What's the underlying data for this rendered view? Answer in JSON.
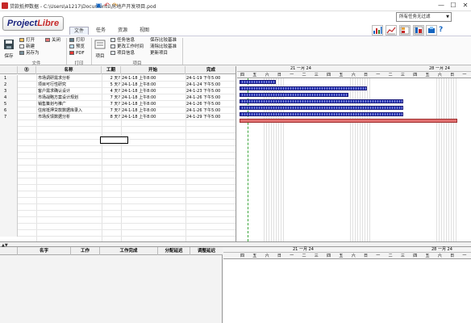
{
  "window": {
    "title": "贷款抵押数据 - C:\\Users\\a1217\\Documents\\房地产开发项目.pod",
    "minimize": "—",
    "maximize": "☐",
    "close": "✕"
  },
  "logo": {
    "text_main": "Project",
    "text_accent": "Libre"
  },
  "tabs": [
    "文件",
    "任务",
    "资源",
    "视图"
  ],
  "filter": {
    "value": "所有任务无过滤"
  },
  "ribbon": {
    "file_group": {
      "save": "保存",
      "open": "打开",
      "close": "关闭",
      "save_as": "另存为",
      "new": "新建",
      "label": "文件"
    },
    "print_group": {
      "print": "打印",
      "preview": "预览",
      "pdf": "PDF",
      "label": "打印"
    },
    "project_group": {
      "projects": "项目",
      "task_info": "任务信息",
      "change_worktime": "更改工作时间",
      "project_info": "项目信息",
      "baseline_set": "保存比较基准",
      "baseline_clear": "清除比较基准",
      "update_project": "更新项目",
      "label": "项目"
    }
  },
  "task_table": {
    "headers": {
      "indicator": "⓪",
      "name": "名称",
      "duration": "工期",
      "start": "开始",
      "finish": "完成"
    },
    "rows": [
      {
        "id": "1",
        "name": "市场调研需求分析",
        "duration": "2 天?",
        "start": "24-1-18 上午8:00",
        "finish": "24-1-19 下午5:00"
      },
      {
        "id": "2",
        "name": "项目可行性研究",
        "duration": "5 天?",
        "start": "24-1-18 上午8:00",
        "finish": "24-1-24 下午5:00"
      },
      {
        "id": "3",
        "name": "客户需求确认设计",
        "duration": "4 天?",
        "start": "24-1-18 上午8:00",
        "finish": "24-1-23 下午5:00"
      },
      {
        "id": "4",
        "name": "市场战略方案设计规划",
        "duration": "7 天?",
        "start": "24-1-18 上午8:00",
        "finish": "24-1-26 下午5:00"
      },
      {
        "id": "5",
        "name": "销售策划与推广",
        "duration": "7 天?",
        "start": "24-1-18 上午8:00",
        "finish": "24-1-26 下午5:00"
      },
      {
        "id": "6",
        "name": "住房抵押贷款数据库录入",
        "duration": "7 天?",
        "start": "24-1-18 上午8:00",
        "finish": "24-1-26 下午5:00"
      },
      {
        "id": "7",
        "name": "市场反馈数据分析",
        "duration": "8 天?",
        "start": "24-1-18 上午8:00",
        "finish": "24-1-29 下午5:00"
      }
    ]
  },
  "gantt": {
    "week1_label": "21 一月 24",
    "week2_label": "28 一月 24",
    "days": [
      "四",
      "五",
      "六",
      "日",
      "一",
      "二",
      "三",
      "四",
      "五",
      "六",
      "日",
      "一",
      "二",
      "三",
      "四",
      "五",
      "六",
      "日",
      "一"
    ],
    "bars": [
      {
        "task": "1",
        "start_day": 0,
        "days": 2,
        "critical": false
      },
      {
        "task": "2",
        "start_day": 0,
        "days": 7,
        "critical": false
      },
      {
        "task": "3",
        "start_day": 0,
        "days": 6,
        "critical": false
      },
      {
        "task": "4",
        "start_day": 0,
        "days": 9,
        "critical": false
      },
      {
        "task": "5",
        "start_day": 0,
        "days": 9,
        "critical": false
      },
      {
        "task": "6",
        "start_day": 0,
        "days": 9,
        "critical": false
      },
      {
        "task": "7",
        "start_day": 0,
        "days": 12,
        "critical": true
      }
    ]
  },
  "resource_table": {
    "headers": [
      "名字",
      "工作",
      "工作完成",
      "分配延迟",
      "调整延迟"
    ]
  },
  "resource_gantt": {
    "week1_label": "21 一月 24",
    "week2_label": "28 一月 24",
    "days": [
      "四",
      "五",
      "六",
      "日",
      "一",
      "二",
      "三",
      "四",
      "五",
      "六",
      "日",
      "一",
      "二",
      "三",
      "四",
      "五",
      "六",
      "日",
      "一"
    ]
  },
  "colors": {
    "bar_blue": "#2c39b3",
    "bar_critical": "#e07070",
    "today_line": "#3aa53a",
    "logo_blue": "#1a237e",
    "logo_red": "#c62828"
  }
}
